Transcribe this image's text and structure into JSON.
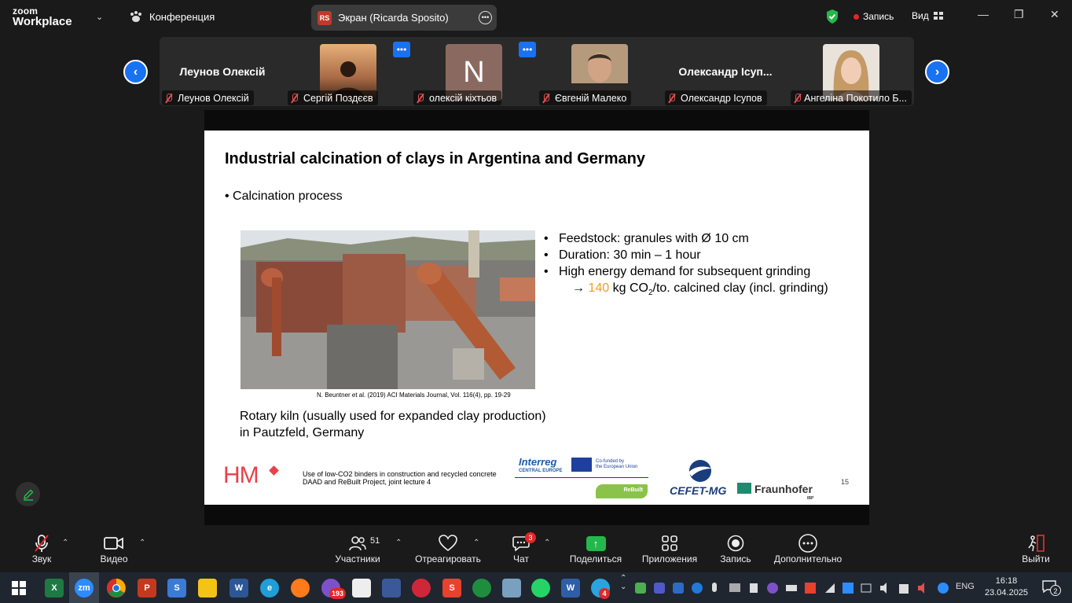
{
  "app": {
    "brand_line1": "zoom",
    "brand_line2": "Workplace",
    "meeting_label": "Конференция",
    "share_initials": "RS",
    "share_title": "Экран (Ricarda Sposito)",
    "record_label": "Запись",
    "view_label": "Вид"
  },
  "participants": [
    {
      "display": "Леунов Олексій",
      "label": "Леунов Олексій",
      "kind": "name"
    },
    {
      "display": "",
      "label": "Сергій Поздєєв",
      "kind": "photo"
    },
    {
      "display": "N",
      "label": "олексій кіхтьов",
      "kind": "initial"
    },
    {
      "display": "",
      "label": "Євгеній Малеко",
      "kind": "photo"
    },
    {
      "display": "Олександр Ісуп...",
      "label": "Олександр Ісупов",
      "kind": "name"
    },
    {
      "display": "",
      "label": "Ангеліна Покотило Б...",
      "kind": "photo"
    }
  ],
  "slide": {
    "title": "Industrial calcination of clays in Argentina and Germany",
    "bullet": "• Calcination process",
    "citation": "N. Beuntner et al. (2019) ACI Materials Journal, Vol. 116(4), pp. 19-29",
    "points": [
      "Feedstock: granules with Ø 10 cm",
      "Duration: 30 min – 1 hour",
      "High energy demand for subsequent grinding"
    ],
    "arrow_prefix": "→ ",
    "arrow_value": "140",
    "arrow_mid": " kg CO",
    "arrow_sub": "2",
    "arrow_suffix": "/to. calcined clay (incl. grinding)",
    "caption_line1": "Rotary kiln (usually used for expanded clay production)",
    "caption_line2": "in Pautzfeld, Germany",
    "footer_logo": "HM",
    "footer_line1": "Use of low-CO2 binders in construction and recycled concrete",
    "footer_line2": "DAAD and ReBuilt Project, joint lecture 4",
    "interreg_title": "Interreg",
    "interreg_sub": "CENTRAL EUROPE",
    "eu_text_1": "Co-funded by",
    "eu_text_2": "the European Union",
    "rebuilt": "ReBuilt",
    "cefet": "CEFET-MG",
    "fraunhofer": "Fraunhofer",
    "fraunhofer_sub": "IBP",
    "page_number": "15"
  },
  "controls": {
    "audio": "Звук",
    "video": "Видео",
    "participants": "Участники",
    "participants_count": "51",
    "react": "Отреагировать",
    "chat": "Чат",
    "chat_badge": "3",
    "share": "Поделиться",
    "apps": "Приложения",
    "record": "Запись",
    "more": "Дополнительно",
    "leave": "Выйти"
  },
  "taskbar": {
    "viber_badge": "193",
    "telegram_badge": "4",
    "lang": "ENG",
    "time": "16:18",
    "date": "23.04.2025",
    "notif": "2"
  },
  "colors": {
    "accent": "#1872f2",
    "share_green": "#23b84c",
    "record_red": "#e02828",
    "orange": "#f39c1e"
  }
}
